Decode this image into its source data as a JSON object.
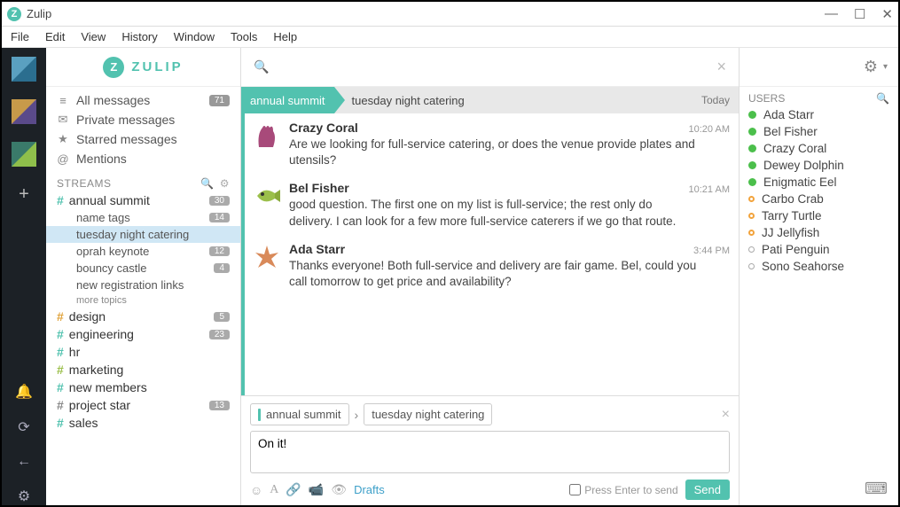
{
  "title": "Zulip",
  "menus": [
    "File",
    "Edit",
    "View",
    "History",
    "Window",
    "Tools",
    "Help"
  ],
  "brand": "ZULIP",
  "nav": [
    {
      "icon": "align",
      "label": "All messages",
      "badge": "71"
    },
    {
      "icon": "mail",
      "label": "Private messages"
    },
    {
      "icon": "star",
      "label": "Starred messages"
    },
    {
      "icon": "at",
      "label": "Mentions"
    }
  ],
  "streamsHeader": "STREAMS",
  "streams": [
    {
      "name": "annual summit",
      "color": "#52c2af",
      "badge": "30",
      "expanded": true,
      "topics": [
        {
          "name": "name tags",
          "badge": "14"
        },
        {
          "name": "tuesday night catering",
          "active": true
        },
        {
          "name": "oprah keynote",
          "badge": "12"
        },
        {
          "name": "bouncy castle",
          "badge": "4"
        },
        {
          "name": "new registration links"
        }
      ],
      "more": "more topics"
    },
    {
      "name": "design",
      "color": "#e0a33c",
      "badge": "5"
    },
    {
      "name": "engineering",
      "color": "#52c2af",
      "badge": "23"
    },
    {
      "name": "hr",
      "color": "#52c2af"
    },
    {
      "name": "marketing",
      "color": "#9bbf4b"
    },
    {
      "name": "new members",
      "color": "#52c2af"
    },
    {
      "name": "project star",
      "color": "#888",
      "badge": "13"
    },
    {
      "name": "sales",
      "color": "#52c2af"
    }
  ],
  "breadcrumb": {
    "stream": "annual summit",
    "topic": "tuesday night catering",
    "date": "Today"
  },
  "messages": [
    {
      "sender": "Crazy Coral",
      "time": "10:20 AM",
      "avatar": "coral",
      "body": "Are we looking for full-service catering, or does the venue provide plates and utensils?"
    },
    {
      "sender": "Bel Fisher",
      "time": "10:21 AM",
      "avatar": "fish",
      "body": "good question. The first one on my list is full-service; the rest only do delivery. I can look for a few more full-service caterers if we go that route."
    },
    {
      "sender": "Ada Starr",
      "time": "3:44 PM",
      "avatar": "star",
      "body": "Thanks everyone! Both full-service and delivery are fair game. Bel, could you call tomorrow to get price and availability?"
    }
  ],
  "compose": {
    "stream": "annual summit",
    "topic": "tuesday night catering",
    "text": "On it!",
    "drafts": "Drafts",
    "pressEnter": "Press Enter to send",
    "send": "Send"
  },
  "usersHeader": "USERS",
  "users": [
    {
      "name": "Ada Starr",
      "status": "green"
    },
    {
      "name": "Bel Fisher",
      "status": "green"
    },
    {
      "name": "Crazy Coral",
      "status": "green"
    },
    {
      "name": "Dewey Dolphin",
      "status": "green"
    },
    {
      "name": "Enigmatic Eel",
      "status": "green"
    },
    {
      "name": "Carbo Crab",
      "status": "orange"
    },
    {
      "name": "Tarry Turtle",
      "status": "orange"
    },
    {
      "name": "JJ Jellyfish",
      "status": "orange"
    },
    {
      "name": "Pati Penguin",
      "status": "empty"
    },
    {
      "name": "Sono Seahorse",
      "status": "empty"
    }
  ]
}
